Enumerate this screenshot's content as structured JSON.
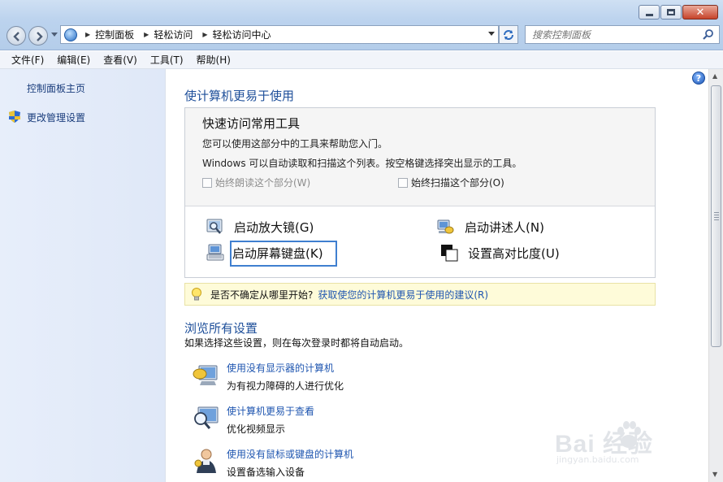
{
  "window": {
    "controls": {
      "minimize": "minimize",
      "maximize": "maximize",
      "close": "close"
    }
  },
  "address_bar": {
    "crumbs": [
      "控制面板",
      "轻松访问",
      "轻松访问中心"
    ]
  },
  "search": {
    "placeholder": "搜索控制面板"
  },
  "menu": [
    "文件(F)",
    "编辑(E)",
    "查看(V)",
    "工具(T)",
    "帮助(H)"
  ],
  "sidebar": {
    "home_link": "控制面板主页",
    "admin_link": "更改管理设置"
  },
  "main": {
    "title": "使计算机更易于使用",
    "quick_access": {
      "title": "快速访问常用工具",
      "line1": "您可以使用这部分中的工具来帮助您入门。",
      "line2": "Windows 可以自动读取和扫描这个列表。按空格键选择突出显示的工具。",
      "check_read": "始终朗读这个部分(W)",
      "check_scan": "始终扫描这个部分(O)",
      "tools": {
        "magnifier": "启动放大镜(G)",
        "narrator": "启动讲述人(N)",
        "osk": "启动屏幕键盘(K)",
        "contrast": "设置高对比度(U)"
      }
    },
    "tip": {
      "question": "是否不确定从哪里开始?",
      "link": "获取使您的计算机更易于使用的建议(R)"
    },
    "browse": {
      "title": "浏览所有设置",
      "desc": "如果选择这些设置，则在每次登录时都将自动启动。",
      "items": [
        {
          "link": "使用没有显示器的计算机",
          "desc": "为有视力障碍的人进行优化"
        },
        {
          "link": "使计算机更易于查看",
          "desc": "优化视频显示"
        },
        {
          "link": "使用没有鼠标或键盘的计算机",
          "desc": "设置备选输入设备"
        }
      ]
    }
  },
  "watermark": {
    "main": "Bai  经验",
    "sub": "jingyan.baidu.com"
  },
  "colors": {
    "link": "#1f56b0",
    "heading": "#1e4f9a",
    "tip_bg": "#fefbd9",
    "sidebar_bg": "#e7eefa"
  }
}
